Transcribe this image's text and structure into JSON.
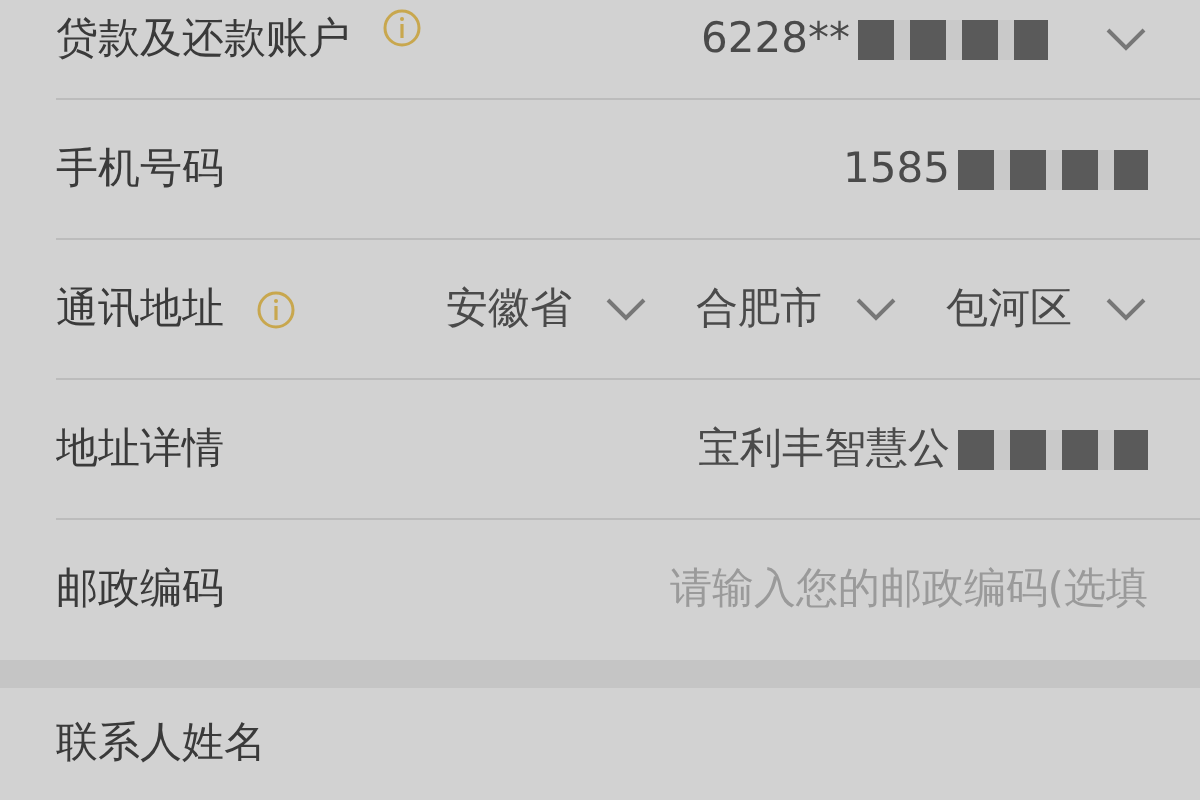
{
  "sections": [
    {
      "rows": [
        {
          "kind": "select",
          "label": "贷款及还款账户",
          "info": true,
          "value": "6228**",
          "redacted": true
        },
        {
          "kind": "text",
          "label": "手机号码",
          "info": false,
          "value": "1585",
          "redacted": true
        },
        {
          "kind": "region",
          "label": "通讯地址",
          "info": true,
          "options": [
            "安徽省",
            "合肥市",
            "包河区"
          ]
        },
        {
          "kind": "text",
          "label": "地址详情",
          "info": false,
          "value": "宝利丰智慧公",
          "redacted": true
        },
        {
          "kind": "input",
          "label": "邮政编码",
          "info": false,
          "placeholder": "请输入您的邮政编码(选填"
        }
      ]
    },
    {
      "rows": [
        {
          "kind": "text",
          "label": "联系人姓名",
          "info": false
        }
      ]
    }
  ]
}
